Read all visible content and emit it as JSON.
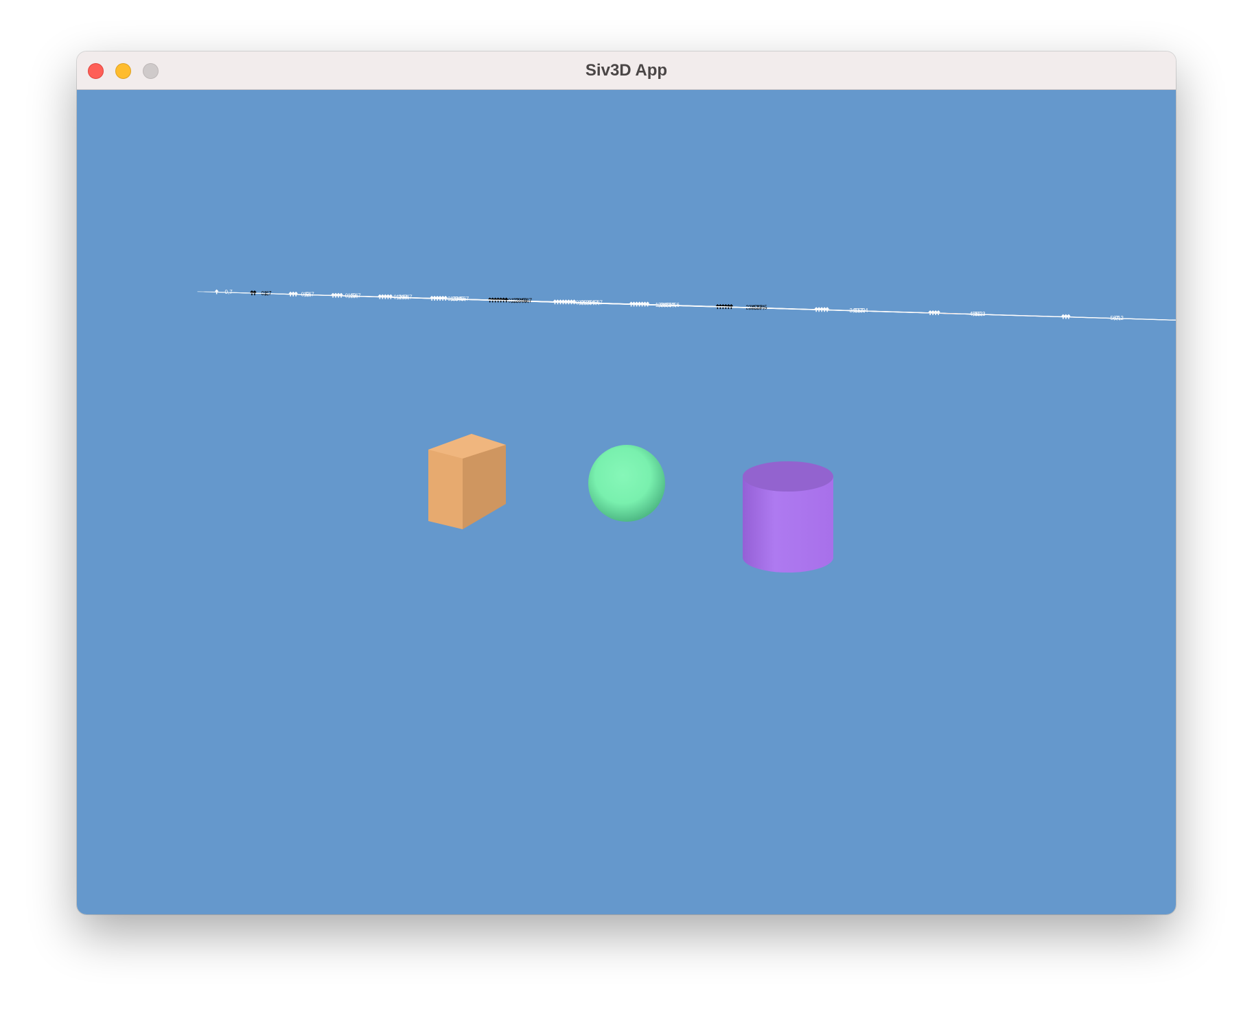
{
  "window": {
    "title": "Siv3D App",
    "buttons": {
      "close": "close-icon",
      "minimize": "minimize-icon",
      "zoom": "zoom-icon"
    }
  },
  "scene": {
    "sky_color": "#6598cc",
    "tiles": [
      {
        "x": 0,
        "y": 0,
        "label": "0,0",
        "color": "#0b5a78",
        "text": "#ffffff"
      },
      {
        "x": 1,
        "y": 0,
        "label": "1,0",
        "color": "#57cdb8",
        "text": "#ffffff"
      },
      {
        "x": 2,
        "y": 0,
        "label": "2,0",
        "color": "#f6e09b",
        "text": "#000000"
      },
      {
        "x": 3,
        "y": 0,
        "label": "3,0",
        "color": "#f1845d",
        "text": "#ffffff"
      },
      {
        "x": 4,
        "y": 0,
        "label": "4,0",
        "color": "#c72a5e",
        "text": "#ffffff"
      },
      {
        "x": 5,
        "y": 0,
        "label": "5,0",
        "color": "#262626",
        "text": "#ffffff"
      },
      {
        "x": 6,
        "y": 0,
        "label": "6,0",
        "color": "#7b7b7b",
        "text": "#ffffff"
      },
      {
        "x": 7,
        "y": 0,
        "label": "7,0",
        "color": "#cfcfcf",
        "text": "#000000"
      },
      {
        "x": 0,
        "y": 1,
        "label": "0,1",
        "color": "#cfcfcf",
        "text": "#000000"
      },
      {
        "x": 1,
        "y": 1,
        "label": "1,1",
        "color": "#0b5a78",
        "text": "#ffffff"
      },
      {
        "x": 2,
        "y": 1,
        "label": "2,1",
        "color": "#57cdb8",
        "text": "#ffffff"
      },
      {
        "x": 3,
        "y": 1,
        "label": "3,1",
        "color": "#f6e09b",
        "text": "#000000"
      },
      {
        "x": 4,
        "y": 1,
        "label": "4,1",
        "color": "#f1845d",
        "text": "#ffffff"
      },
      {
        "x": 5,
        "y": 1,
        "label": "5,1",
        "color": "#c72a5e",
        "text": "#ffffff"
      },
      {
        "x": 6,
        "y": 1,
        "label": "6,1",
        "color": "#262626",
        "text": "#ffffff"
      },
      {
        "x": 7,
        "y": 1,
        "label": "7,1",
        "color": "#7b7b7b",
        "text": "#ffffff"
      },
      {
        "x": 0,
        "y": 2,
        "label": "0,2",
        "color": "#7b7b7b",
        "text": "#ffffff"
      },
      {
        "x": 1,
        "y": 2,
        "label": "1,2",
        "color": "#cfcfcf",
        "text": "#000000"
      },
      {
        "x": 2,
        "y": 2,
        "label": "2,2",
        "color": "#0b5a78",
        "text": "#ffffff"
      },
      {
        "x": 3,
        "y": 2,
        "label": "3,2",
        "color": "#57cdb8",
        "text": "#ffffff"
      },
      {
        "x": 4,
        "y": 2,
        "label": "4,2",
        "color": "#f6e09b",
        "text": "#000000"
      },
      {
        "x": 5,
        "y": 2,
        "label": "5,2",
        "color": "#f1845d",
        "text": "#ffffff"
      },
      {
        "x": 6,
        "y": 2,
        "label": "6,2",
        "color": "#c72a5e",
        "text": "#ffffff"
      },
      {
        "x": 7,
        "y": 2,
        "label": "7,2",
        "color": "#262626",
        "text": "#ffffff"
      },
      {
        "x": 0,
        "y": 3,
        "label": "0,3",
        "color": "#262626",
        "text": "#ffffff"
      },
      {
        "x": 1,
        "y": 3,
        "label": "1,3",
        "color": "#7b7b7b",
        "text": "#ffffff"
      },
      {
        "x": 2,
        "y": 3,
        "label": "2,3",
        "color": "#cfcfcf",
        "text": "#000000"
      },
      {
        "x": 3,
        "y": 3,
        "label": "3,3",
        "color": "#0b5a78",
        "text": "#ffffff"
      },
      {
        "x": 4,
        "y": 3,
        "label": "4,3",
        "color": "#57cdb8",
        "text": "#ffffff"
      },
      {
        "x": 5,
        "y": 3,
        "label": "5,3",
        "color": "#f6e09b",
        "text": "#000000"
      },
      {
        "x": 6,
        "y": 3,
        "label": "6,3",
        "color": "#f1845d",
        "text": "#ffffff"
      },
      {
        "x": 7,
        "y": 3,
        "label": "7,3",
        "color": "#c72a5e",
        "text": "#ffffff"
      },
      {
        "x": 0,
        "y": 4,
        "label": "0,4",
        "color": "#c72a5e",
        "text": "#ffffff"
      },
      {
        "x": 1,
        "y": 4,
        "label": "1,4",
        "color": "#262626",
        "text": "#ffffff"
      },
      {
        "x": 2,
        "y": 4,
        "label": "2,4",
        "color": "#7b7b7b",
        "text": "#ffffff"
      },
      {
        "x": 3,
        "y": 4,
        "label": "3,4",
        "color": "#cfcfcf",
        "text": "#000000"
      },
      {
        "x": 4,
        "y": 4,
        "label": "4,4",
        "color": "#0b5a78",
        "text": "#ffffff"
      },
      {
        "x": 5,
        "y": 4,
        "label": "5,4",
        "color": "#57cdb8",
        "text": "#ffffff"
      },
      {
        "x": 6,
        "y": 4,
        "label": "6,4",
        "color": "#f6e09b",
        "text": "#000000"
      },
      {
        "x": 7,
        "y": 4,
        "label": "7,4",
        "color": "#f1845d",
        "text": "#ffffff"
      },
      {
        "x": 0,
        "y": 5,
        "label": "0,5",
        "color": "#f1845d",
        "text": "#ffffff"
      },
      {
        "x": 1,
        "y": 5,
        "label": "1,5",
        "color": "#c72a5e",
        "text": "#ffffff"
      },
      {
        "x": 2,
        "y": 5,
        "label": "2,5",
        "color": "#262626",
        "text": "#ffffff"
      },
      {
        "x": 3,
        "y": 5,
        "label": "3,5",
        "color": "#7b7b7b",
        "text": "#ffffff"
      },
      {
        "x": 4,
        "y": 5,
        "label": "4,5",
        "color": "#cfcfcf",
        "text": "#000000"
      },
      {
        "x": 5,
        "y": 5,
        "label": "5,5",
        "color": "#0b5a78",
        "text": "#ffffff"
      },
      {
        "x": 6,
        "y": 5,
        "label": "6,5",
        "color": "#57cdb8",
        "text": "#ffffff"
      },
      {
        "x": 7,
        "y": 5,
        "label": "7,5",
        "color": "#f6e09b",
        "text": "#000000"
      },
      {
        "x": 0,
        "y": 6,
        "label": "0,6",
        "color": "#f6e09b",
        "text": "#000000"
      },
      {
        "x": 1,
        "y": 6,
        "label": "1,6",
        "color": "#f1845d",
        "text": "#ffffff"
      },
      {
        "x": 2,
        "y": 6,
        "label": "2,6",
        "color": "#c72a5e",
        "text": "#ffffff"
      },
      {
        "x": 3,
        "y": 6,
        "label": "3,6",
        "color": "#262626",
        "text": "#ffffff"
      },
      {
        "x": 4,
        "y": 6,
        "label": "4,6",
        "color": "#7b7b7b",
        "text": "#ffffff"
      },
      {
        "x": 5,
        "y": 6,
        "label": "5,6",
        "color": "#cfcfcf",
        "text": "#000000"
      },
      {
        "x": 6,
        "y": 6,
        "label": "6,6",
        "color": "#0b5a78",
        "text": "#ffffff"
      },
      {
        "x": 7,
        "y": 6,
        "label": "7,6",
        "color": "#57cdb8",
        "text": "#ffffff"
      },
      {
        "x": 0,
        "y": 7,
        "label": "0,7",
        "color": "#57cdb8",
        "text": "#ffffff"
      },
      {
        "x": 1,
        "y": 7,
        "label": "1,7",
        "color": "#f6e09b",
        "text": "#000000"
      },
      {
        "x": 2,
        "y": 7,
        "label": "2,7",
        "color": "#f1845d",
        "text": "#ffffff"
      },
      {
        "x": 3,
        "y": 7,
        "label": "3,7",
        "color": "#c72a5e",
        "text": "#ffffff"
      },
      {
        "x": 4,
        "y": 7,
        "label": "4,7",
        "color": "#262626",
        "text": "#ffffff"
      },
      {
        "x": 5,
        "y": 7,
        "label": "5,7",
        "color": "#7b7b7b",
        "text": "#ffffff"
      },
      {
        "x": 6,
        "y": 7,
        "label": "6,7",
        "color": "#cfcfcf",
        "text": "#000000"
      },
      {
        "x": 7,
        "y": 7,
        "label": "7,7",
        "color": "#0b5a78",
        "text": "#ffffff"
      }
    ],
    "objects": [
      {
        "name": "box",
        "color": "#e7aa6f"
      },
      {
        "name": "sphere",
        "color": "#79f0ae"
      },
      {
        "name": "cylinder",
        "color": "#a36fe0"
      }
    ]
  }
}
